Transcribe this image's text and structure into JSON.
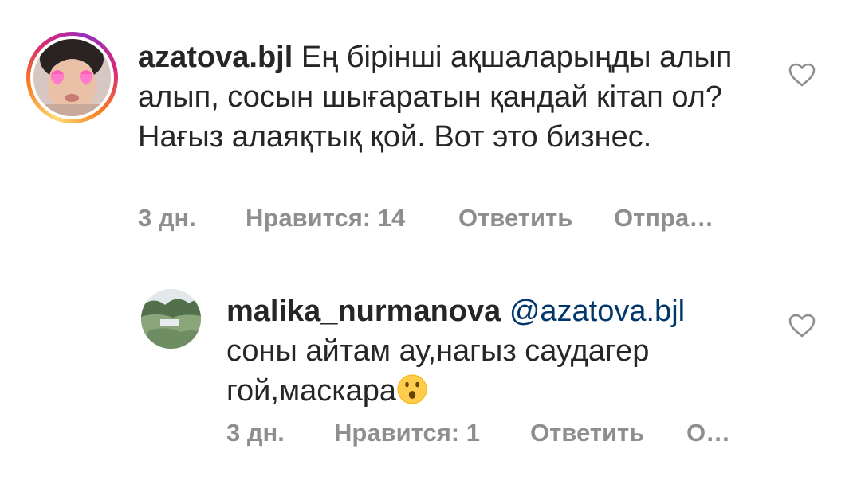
{
  "comments": [
    {
      "username": "azatova.bjl",
      "text": "Ең бірінші ақшаларыңды алып алып,  сосын шығаратын қандай кітап ол? Нағыз алаяқтық қой. Вот это бизнес.",
      "time": "3 дн.",
      "likes": "Нравится: 14",
      "reply_label": "Ответить",
      "send_label": "Отпра…",
      "story_ring": true,
      "icons": {
        "like": "heart-outline-icon"
      }
    },
    {
      "username": "malika_nurmanova",
      "mention": "@azatova.bjl",
      "text": "соны айтам ау,нагыз саудагер гой,маскара",
      "emoji": "hushed-face-emoji",
      "time": "3 дн.",
      "likes": "Нравится: 1",
      "reply_label": "Ответить",
      "send_label": "О…",
      "icons": {
        "like": "heart-outline-icon"
      }
    }
  ],
  "colors": {
    "text": "#262626",
    "meta": "#8e8e8e",
    "mention": "#00376b",
    "ring_start": "#feda75",
    "ring_end": "#d62976"
  }
}
